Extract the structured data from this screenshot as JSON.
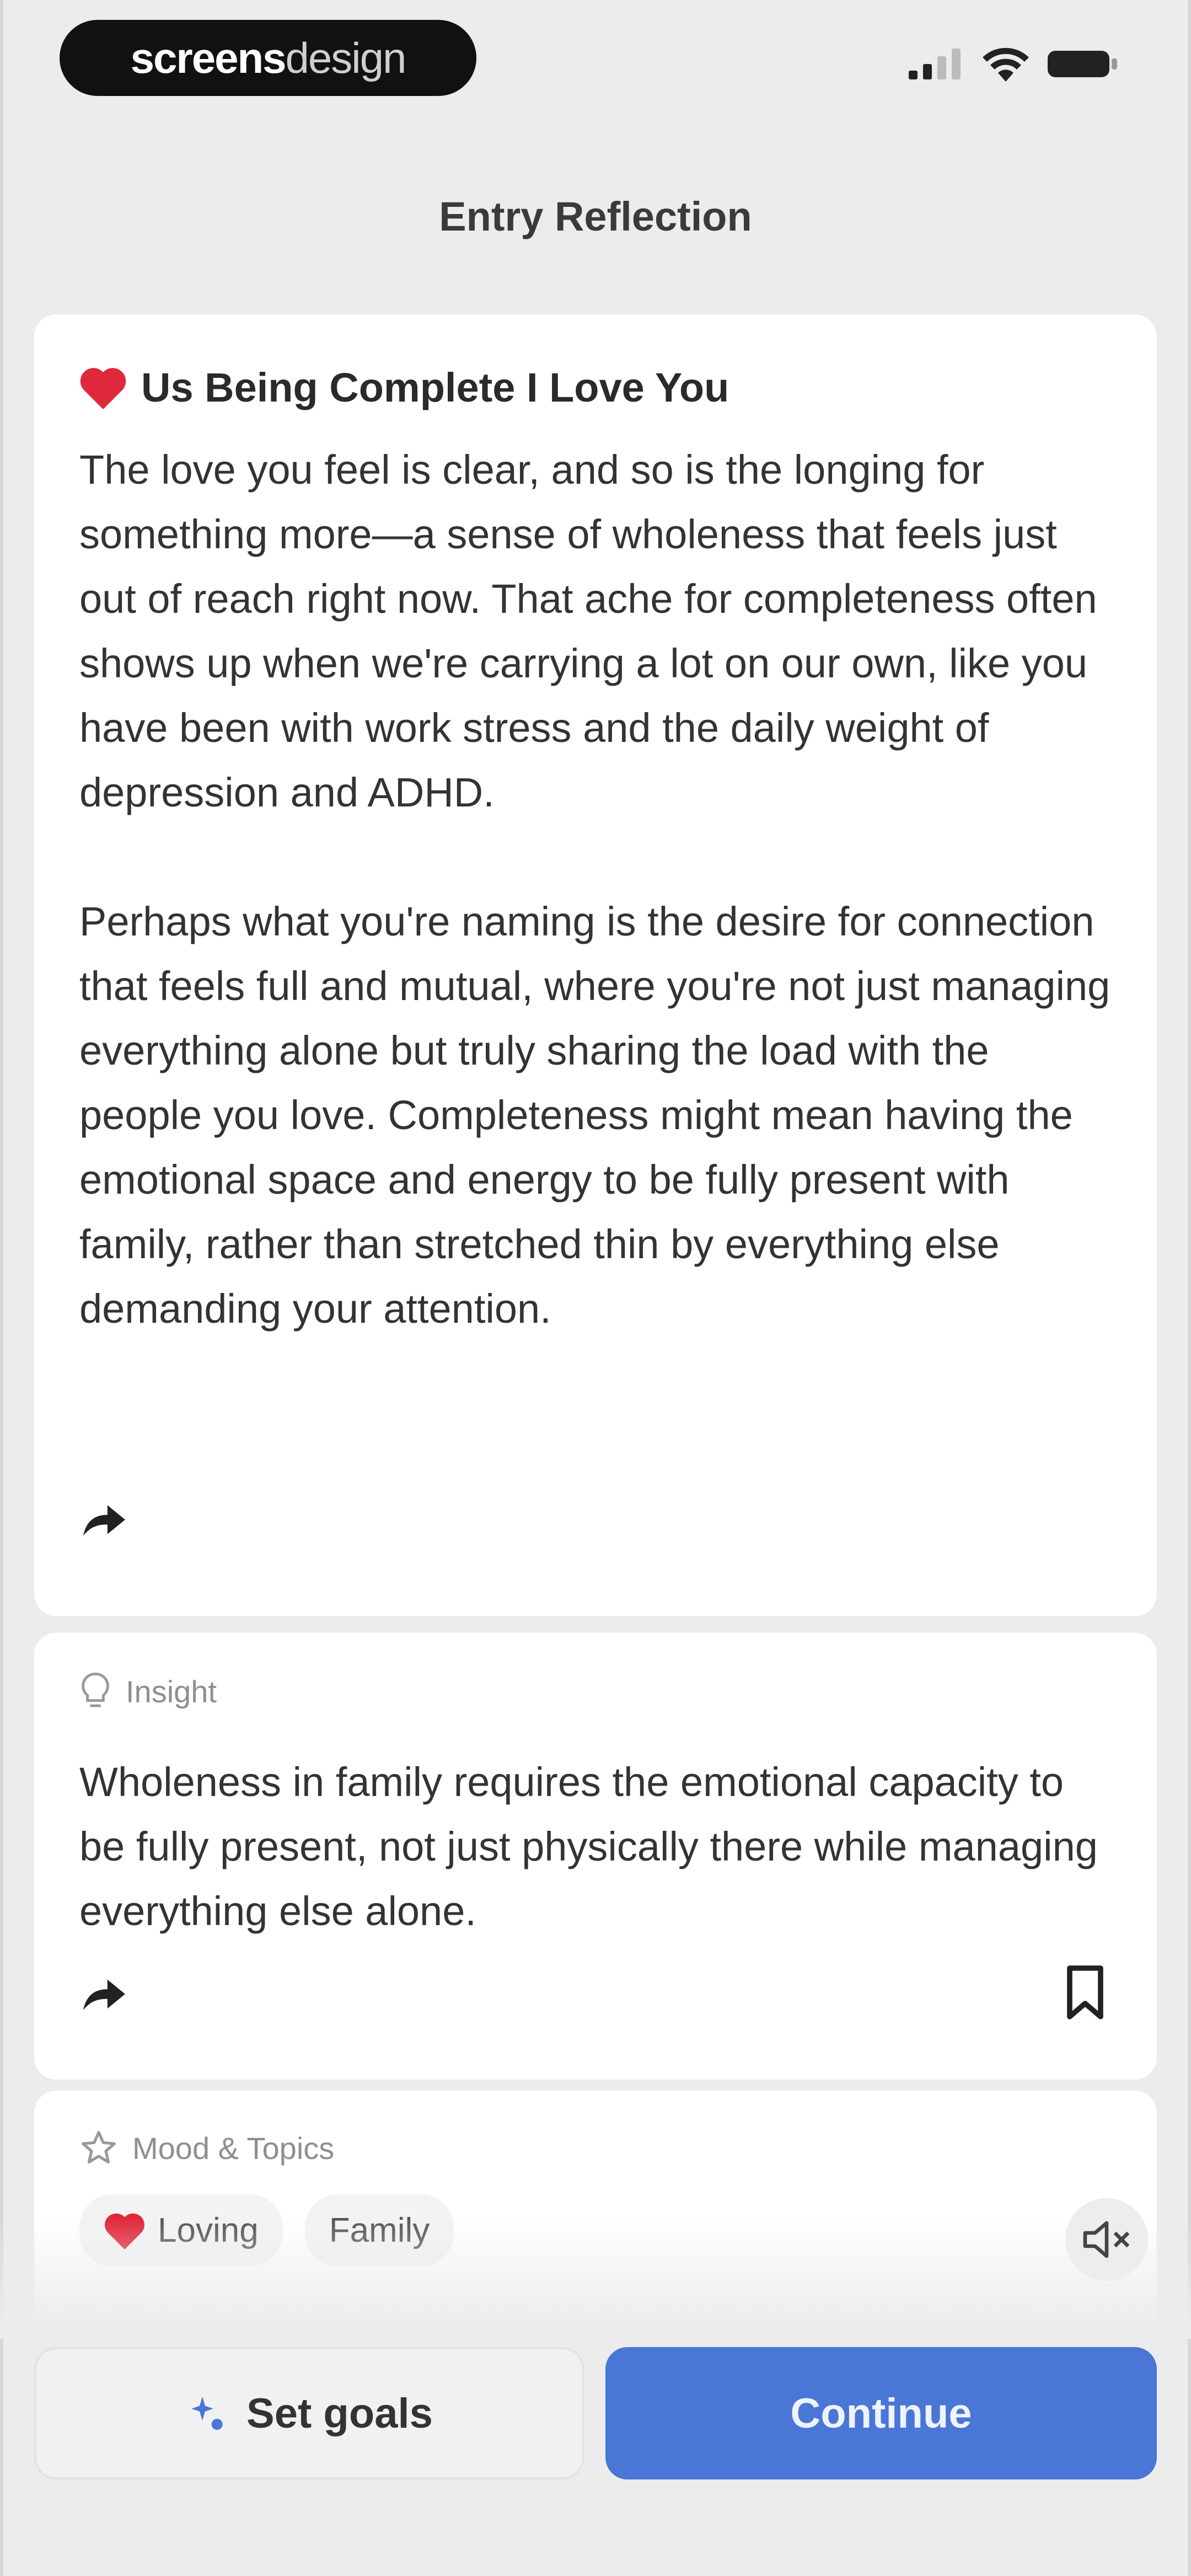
{
  "status_bar": {
    "brand_primary": "screens",
    "brand_secondary": "design",
    "icons": [
      "signal-icon",
      "wifi-icon",
      "battery-icon"
    ]
  },
  "header": {
    "title": "Entry Reflection"
  },
  "entry": {
    "heading": "Us Being Complete I Love You",
    "paragraphs": [
      "The love you feel is clear, and so is the longing for something more—a sense of wholeness that feels just out of reach right now. That ache for completeness often shows up when we're carrying a lot on our own, like you have been with work stress and the daily weight of depression and ADHD.",
      "Perhaps what you're naming is the desire for connection that feels full and mutual, where you're not just managing everything alone but truly sharing the load with the people you love. Completeness might mean having the emotional space and energy to be fully present with family, rather than stretched thin by everything else demanding your attention."
    ]
  },
  "insight": {
    "label": "Insight",
    "text": "Wholeness in family requires the emotional capacity to be fully present, not just physically there while managing everything else alone."
  },
  "mood": {
    "label": "Mood & Topics",
    "chips": [
      {
        "label": "Loving",
        "icon": "heart-icon"
      },
      {
        "label": "Family"
      }
    ]
  },
  "actions": {
    "set_goals": "Set goals",
    "continue": "Continue"
  },
  "colors": {
    "accent": "#4a76d6",
    "heart": "#e0283b",
    "background": "#ececec",
    "card": "#ffffff"
  }
}
